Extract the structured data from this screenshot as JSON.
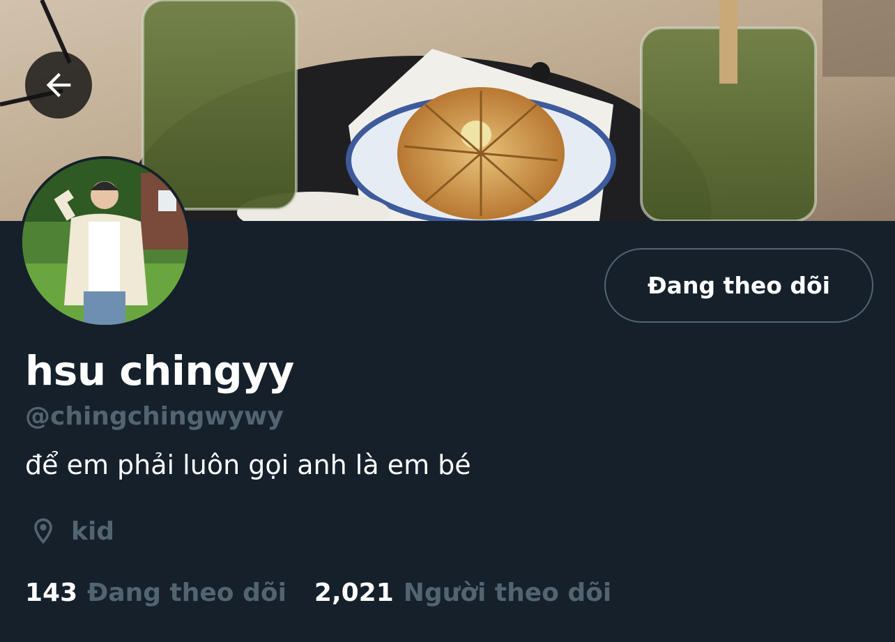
{
  "header": {
    "back_icon": "arrow-left-icon",
    "banner_image": "cover-photo-matcha-drinks-and-bread"
  },
  "profile": {
    "avatar": "profile-photo",
    "follow_button_label": "Đang theo dõi",
    "display_name": "hsu chingyy",
    "handle": "@chingchingwywy",
    "bio": "để em phải luôn gọi anh là em bé",
    "location_icon": "location-pin-icon",
    "location": "kid"
  },
  "stats": {
    "following_count": "143",
    "following_label": "Đang theo dõi",
    "followers_count": "2,021",
    "followers_label": "Người theo dõi"
  },
  "colors": {
    "background": "#15202b",
    "muted_text": "#536471",
    "primary_text": "#ffffff",
    "button_border": "#536471"
  }
}
